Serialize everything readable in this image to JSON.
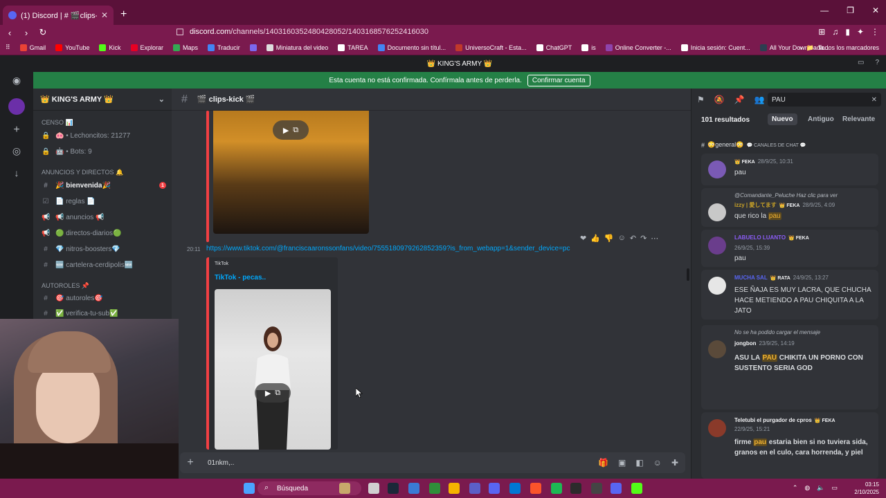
{
  "browser": {
    "tab_title": "(1) Discord | # 🎬clips-kick🎬 | ’",
    "url_domain": "discord.com",
    "url_path": "/channels/1403160352480428052/1403168576252416030",
    "bookmarks": [
      {
        "label": "Gmail",
        "color": "#ea4335"
      },
      {
        "label": "YouTube",
        "color": "#ff0000"
      },
      {
        "label": "Kick",
        "color": "#53fc18"
      },
      {
        "label": "Explorar",
        "color": "#e60023"
      },
      {
        "label": "Maps",
        "color": "#34a853"
      },
      {
        "label": "Traducir",
        "color": "#4285f4"
      },
      {
        "label": "",
        "color": "#7b68ee"
      },
      {
        "label": "Miniatura del video",
        "color": "#dddddd"
      },
      {
        "label": "TAREA",
        "color": "#ffffff"
      },
      {
        "label": "Documento sin títul...",
        "color": "#4285f4"
      },
      {
        "label": "UniversoCraft - Esta...",
        "color": "#c0392b"
      },
      {
        "label": "ChatGPT",
        "color": "#ffffff"
      },
      {
        "label": "is",
        "color": "#ffffff"
      },
      {
        "label": "Online Converter -...",
        "color": "#8e44ad"
      },
      {
        "label": "Inicia sesión: Cuent...",
        "color": "#ffffff"
      },
      {
        "label": "All Your Downloada...",
        "color": "#2c3e50"
      }
    ],
    "bookmarks_folder": "Todos los marcadores"
  },
  "discord": {
    "top_title": "👑 KING'S ARMY 👑",
    "banner_text": "Esta cuenta no está confirmada. Confírmala antes de perderla.",
    "banner_button": "Confirmar cuenta",
    "guild_name": "👑 KING'S ARMY 👑",
    "categories": {
      "censo": "CENSO 📊",
      "anuncios": "ANUNCIOS Y DIRECTOS 🔔",
      "autoroles": "AUTOROLES 📌"
    },
    "censo_channels": [
      "🐽 • Lechoncitos: 21277",
      "🤖 • Bots: 9"
    ],
    "channels": [
      {
        "label": "🎉 bienvenida🎉",
        "badge": "1"
      },
      {
        "label": "📄 reglas 📄"
      },
      {
        "label": "📢 anuncios 📢"
      },
      {
        "label": "🟢 directos-diarios🟢"
      },
      {
        "label": "💎 nitros-boosters💎"
      },
      {
        "label": "🆕 cartelera-cerdipolis🆕"
      }
    ],
    "autorole_channels": [
      "🎯 autoroles🎯",
      "✅ verifica-tu-sub✅"
    ],
    "channel_name": "🎬 clips-kick 🎬",
    "message": {
      "time": "20:11",
      "link": "https://www.tiktok.com/@franciscaaronssonfans/video/7555180979262852359?is_from_webapp=1&sender_device=pc",
      "embed_provider": "TikTok",
      "embed_title": "TikTok - pecas.."
    },
    "composer_text": "01nkm,.."
  },
  "search": {
    "query": "PAU",
    "results_count": "101 resultados",
    "sort_options": [
      "Nuevo",
      "Antiguo",
      "Relevante"
    ],
    "group_channel": "😳general😳",
    "group_category": "💬 CANALES DE CHAT 💬",
    "results": [
      {
        "meta": "👑 FEKA",
        "date": "28/9/25, 10:31",
        "body": "pau",
        "avatar_color": "#7a5ab5"
      },
      {
        "reply": "@Comandante_Peluche",
        "reply_hint": "Haz clic para ver",
        "name": "izzy | 愛してます",
        "tag": "👑 FEKA",
        "date": "28/9/25, 4:09",
        "body_pre": "que rico la ",
        "body_hl": "pau",
        "avatar_color": "#c8c8c8"
      },
      {
        "name": "LABUELO LUANTO",
        "tag": "👑 FEKA",
        "date": "26/9/25, 15:39",
        "body": "pau",
        "avatar_color": "#6a3d8c"
      },
      {
        "name": "MUCHA SAL",
        "tag": "👑 RATA",
        "date": "24/9/25, 13:27",
        "body": "ESE ÑAJA ES MUY LACRA, QUE CHUCHA HACE METIENDO A PAU CHIQUITA A LA JATO",
        "avatar_color": "#e6e6e6"
      },
      {
        "reply": "No se ha podido cargar el mensaje",
        "name": "jongbon",
        "date": "23/9/25, 14:19",
        "body_pre": "ASU LA ",
        "body_hl": "PAU",
        "body_post": " CHIKITA UN PORNO CON SUSTENTO SERIA GOD",
        "avatar_color": "#5a4a3a"
      },
      {
        "name": "Teletubi el purgador de cpros",
        "tag": "👑 FEKA",
        "date": "22/9/25, 15:21",
        "body_pre": "firme ",
        "body_hl": "pau",
        "body_post": " estaria bien si no tuviera sida, granos en el culo, cara horrenda, y piel",
        "avatar_color": "#8a3a2a"
      }
    ]
  },
  "taskbar": {
    "search_label": "Búsqueda",
    "time": "03:15",
    "date": "2/10/2025"
  },
  "colors": {
    "chrome": "#7a1a4e",
    "discord_bg": "#313338",
    "green_banner": "#248046",
    "link": "#00a8fc",
    "mention_red": "#f23f43"
  }
}
